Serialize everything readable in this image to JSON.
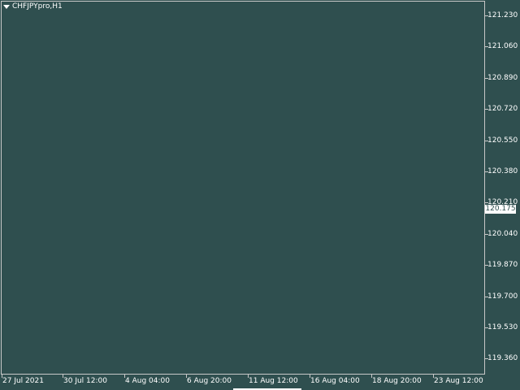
{
  "window": {
    "symbol": "CHFJPYpro,H1"
  },
  "price_axis": {
    "labels": [
      "121.230",
      "121.060",
      "120.890",
      "120.720",
      "120.550",
      "120.380",
      "120.210",
      "120.040",
      "119.870",
      "119.700",
      "119.530",
      "119.360"
    ],
    "current_price": "120.175"
  },
  "time_axis": {
    "labels": [
      "27 Jul 2021",
      "30 Jul 12:00",
      "4 Aug 04:00",
      "6 Aug 20:00",
      "11 Aug 12:00",
      "16 Aug 04:00",
      "18 Aug 20:00",
      "23 Aug 12:00"
    ]
  },
  "colors": {
    "background": "#2f4f4f",
    "foreground": "#ffffff",
    "grid_border": "#c8c8c8"
  }
}
